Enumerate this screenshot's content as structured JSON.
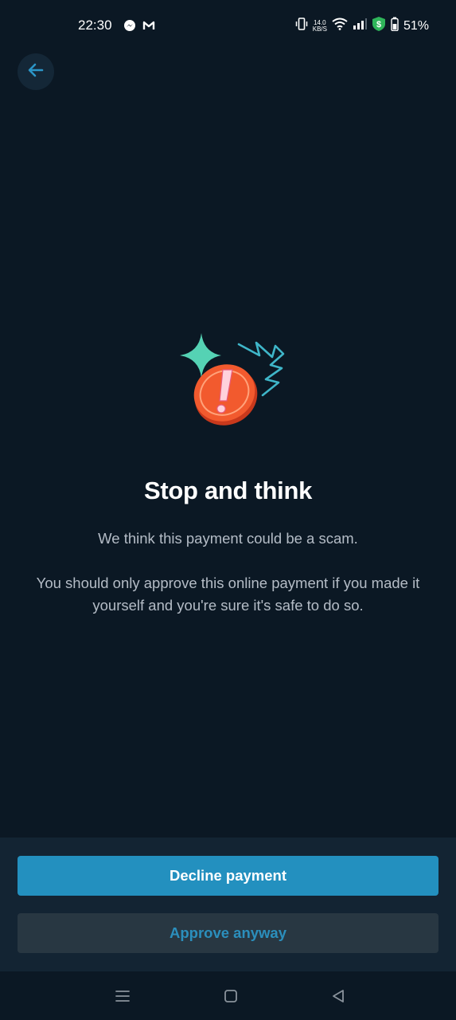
{
  "status_bar": {
    "time": "22:30",
    "netspeed_value": "14.0",
    "netspeed_unit": "KB/S",
    "battery_percent": "51%",
    "icons": [
      "messenger-icon",
      "gmail-icon",
      "vibrate-icon",
      "wifi-icon",
      "signal-icon",
      "shield-dollar-icon",
      "battery-icon"
    ]
  },
  "header": {
    "back_icon": "arrow-left-icon"
  },
  "warning": {
    "illustration": "warning-exclamation-icon",
    "title": "Stop and think",
    "message_1": "We think this payment could be a scam.",
    "message_2": "You should only approve this online payment if you made it yourself and you're sure it's safe to do so."
  },
  "actions": {
    "decline_label": "Decline payment",
    "approve_label": "Approve anyway"
  },
  "navigation": {
    "icons": [
      "recents-icon",
      "home-icon",
      "back-triangle-icon"
    ]
  },
  "colors": {
    "background": "#0b1824",
    "primary_button": "#2390bf",
    "secondary_button": "#283742",
    "accent_text": "#2b8fbd",
    "warning_orange": "#f25a2e",
    "sparkle_teal": "#55d2b4"
  }
}
